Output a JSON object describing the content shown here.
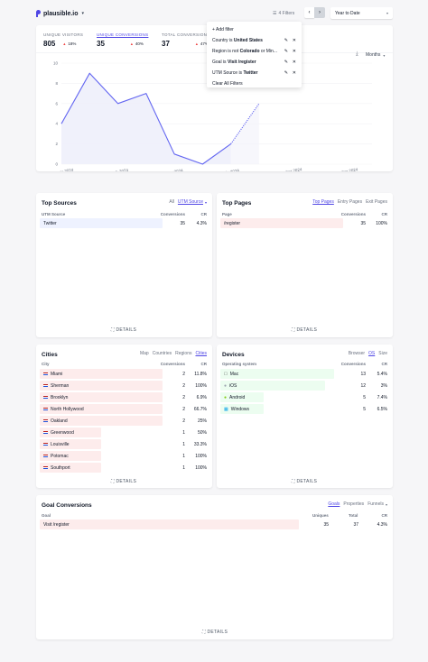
{
  "topbar": {
    "site_name": "plausible.io",
    "filters_label": "4 Filters",
    "date_range": "Year to Date"
  },
  "stats": {
    "unique_visitors": {
      "label": "UNIQUE VISITORS",
      "value": "805",
      "change": "18%"
    },
    "unique_conversions": {
      "label": "UNIQUE CONVERSIONS",
      "value": "35",
      "change": "40%"
    },
    "total_conversions": {
      "label": "TOTAL CONVERSIONS",
      "value": "37",
      "change": "47%"
    }
  },
  "interval_label": "Months",
  "filter_menu": {
    "add": "+ Add filter",
    "items": [
      {
        "prefix": "Country is ",
        "value": "United States"
      },
      {
        "prefix": "Region is not ",
        "value": "Colorado",
        "suffix": " or Min..."
      },
      {
        "prefix": "Goal is ",
        "value": "Visit /register"
      },
      {
        "prefix": "UTM Source is ",
        "value": "Twitter"
      }
    ],
    "clear": "Clear All Filters"
  },
  "chart_data": {
    "type": "line",
    "x": [
      "January 2024",
      "February 2024",
      "March 2024",
      "April 2024",
      "May 2024",
      "June 2024",
      "July 2024",
      "August 2024"
    ],
    "x_tick_labels": [
      "January 2024",
      "March 2024",
      "May 2024",
      "July 2024",
      "September 2024",
      "November 2024"
    ],
    "values": [
      4,
      9,
      6,
      7,
      1,
      0,
      2,
      6
    ],
    "projected_from_index": 6,
    "ylim": [
      0,
      10
    ],
    "y_ticks": [
      "0",
      "2",
      "4",
      "6",
      "8",
      "10"
    ],
    "color": "#6366f1"
  },
  "top_sources": {
    "title": "Top Sources",
    "tabs": [
      "All",
      "UTM Source"
    ],
    "col1": "UTM Source",
    "col2": "Conversions",
    "col3": "CR",
    "rows": [
      {
        "name": "Twitter",
        "v1": "35",
        "v2": "4.3%",
        "pct": 100
      }
    ],
    "details": "DETAILS"
  },
  "top_pages": {
    "title": "Top Pages",
    "tabs": [
      "Top Pages",
      "Entry Pages",
      "Exit Pages"
    ],
    "col1": "Page",
    "col2": "Conversions",
    "col3": "CR",
    "rows": [
      {
        "name": "/register",
        "v1": "35",
        "v2": "100%",
        "pct": 100
      }
    ],
    "details": "DETAILS"
  },
  "cities": {
    "title": "Cities",
    "tabs": [
      "Map",
      "Countries",
      "Regions",
      "Cities"
    ],
    "col1": "City",
    "col2": "Conversions",
    "col3": "CR",
    "rows": [
      {
        "name": "Miami",
        "v1": "2",
        "v2": "11.8%",
        "pct": 100
      },
      {
        "name": "Sherman",
        "v1": "2",
        "v2": "100%",
        "pct": 100
      },
      {
        "name": "Brooklyn",
        "v1": "2",
        "v2": "6.9%",
        "pct": 100
      },
      {
        "name": "North Hollywood",
        "v1": "2",
        "v2": "66.7%",
        "pct": 100
      },
      {
        "name": "Oakland",
        "v1": "2",
        "v2": "25%",
        "pct": 100
      },
      {
        "name": "Greenwood",
        "v1": "1",
        "v2": "50%",
        "pct": 50
      },
      {
        "name": "Louisville",
        "v1": "1",
        "v2": "33.3%",
        "pct": 50
      },
      {
        "name": "Potomac",
        "v1": "1",
        "v2": "100%",
        "pct": 50
      },
      {
        "name": "Southport",
        "v1": "1",
        "v2": "100%",
        "pct": 50
      }
    ],
    "details": "DETAILS"
  },
  "devices": {
    "title": "Devices",
    "tabs": [
      "Browser",
      "OS",
      "Size"
    ],
    "col1": "Operating system",
    "col2": "Conversions",
    "col3": "CR",
    "rows": [
      {
        "name": "Mac",
        "icon": "apple-icon",
        "v1": "13",
        "v2": "5.4%",
        "pct": 100
      },
      {
        "name": "iOS",
        "icon": "ios-icon",
        "v1": "12",
        "v2": "3%",
        "pct": 92
      },
      {
        "name": "Android",
        "icon": "android-icon",
        "v1": "5",
        "v2": "7.4%",
        "pct": 38
      },
      {
        "name": "Windows",
        "icon": "windows-icon",
        "v1": "5",
        "v2": "6.5%",
        "pct": 38
      }
    ],
    "details": "DETAILS"
  },
  "goals": {
    "title": "Goal Conversions",
    "tabs": [
      "Goals",
      "Properties",
      "Funnels"
    ],
    "col1": "Goal",
    "col2": "Uniques",
    "col3": "Total",
    "col4": "CR",
    "rows": [
      {
        "name": "Visit /register",
        "v1": "35",
        "v2": "37",
        "v3": "4.3%",
        "pct": 100
      }
    ],
    "details": "DETAILS"
  }
}
